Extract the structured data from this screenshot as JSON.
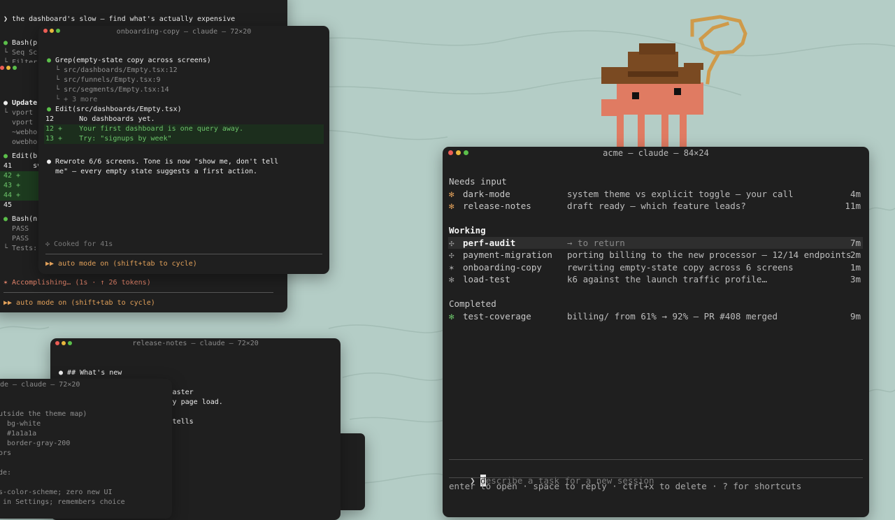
{
  "colors": {
    "background": "#b4cdc6",
    "terminal": "#1f1f1f",
    "accent_orange": "#e2a15a",
    "accent_green": "#6cc46a"
  },
  "term_back": {
    "prompt": "❯ the dashboard's slow — find what's actually expensive",
    "lines": [
      {
        "t": "● Bash(p",
        "c": "gb"
      },
      {
        "t": "└ Seq Sc",
        "c": "grey"
      },
      {
        "t": "└ Filter",
        "c": "grey"
      },
      {
        "t": "● Update",
        "c": "wb"
      },
      {
        "t": "└ vport",
        "c": "grey"
      },
      {
        "t": "  vport",
        "c": "grey"
      },
      {
        "t": "  ~webho",
        "c": "grey"
      },
      {
        "t": "  owebho",
        "c": "grey"
      },
      {
        "t": "● Edit(b",
        "c": "gb"
      },
      {
        "t": "41     sv",
        "c": "white"
      },
      {
        "t": "42 +",
        "c": "green"
      },
      {
        "t": "43 +",
        "c": "green"
      },
      {
        "t": "44 +",
        "c": "green"
      },
      {
        "t": "45",
        "c": "white"
      },
      {
        "t": "● Bash(n",
        "c": "gb"
      },
      {
        "t": "  PASS",
        "c": "grey"
      },
      {
        "t": "  PASS",
        "c": "grey"
      },
      {
        "t": "└ Tests:",
        "c": "grey"
      }
    ],
    "status": "✶ Accomplishing… (1s · ↑ 26 tokens)",
    "footer": "▶▶ auto mode on (shift+tab to cycle)"
  },
  "term_onboarding": {
    "title": "onboarding-copy — claude — 72×20",
    "lines": [
      {
        "t": "● Grep(empty-state copy across screens)",
        "c": "gb"
      },
      {
        "t": "  └ src/dashboards/Empty.tsx:12",
        "c": "grey"
      },
      {
        "t": "  └ src/funnels/Empty.tsx:9",
        "c": "grey"
      },
      {
        "t": "  └ src/segments/Empty.tsx:14",
        "c": "grey"
      },
      {
        "t": "  └ + 3 more",
        "c": "dim"
      },
      {
        "t": "● Edit(src/dashboards/Empty.tsx)",
        "c": "gb"
      },
      {
        "t": "12      No dashboards yet.",
        "c": "white"
      },
      {
        "t": "12 +    Your first dashboard is one query away.",
        "c": "green"
      },
      {
        "t": "13 +    Try: \"signups by week\"",
        "c": "green"
      },
      {
        "t": "",
        "c": "white"
      },
      {
        "t": "● Rewrote 6/6 screens. Tone is now \"show me, don't tell",
        "c": "wdot"
      },
      {
        "t": "  me\" — every empty state suggests a first action.",
        "c": "white"
      }
    ],
    "cooked": "✣ Cooked for 41s",
    "footer": "▶▶ auto mode on (shift+tab to cycle)"
  },
  "term_release": {
    "title": "release-notes — claude — 72×20",
    "lines": [
      "● ## What's new",
      "",
      "      ain query is now 6× faster",
      "      ou'll feel it on every page load.",
      "",
      "      ery blank screen now tells"
    ]
  },
  "term_darkmode": {
    "title": "de — claude — 72×20",
    "lines": [
      "utside the theme map)",
      "  bg-white",
      "  #1a1a1a",
      "  border-gray-200",
      "ors",
      "",
      "de:",
      "",
      "s-color-scheme; zero new UI",
      " in Settings; remembers choice"
    ]
  },
  "main": {
    "title": "acme — claude — 84×24",
    "sections": [
      {
        "heading": "Needs input",
        "bold": false,
        "rows": [
          {
            "icon": "✻",
            "icon_color": "#e2a15a",
            "name": "dark-mode",
            "desc": "system theme vs explicit toggle — your call",
            "time": "4m"
          },
          {
            "icon": "✻",
            "icon_color": "#e2a15a",
            "name": "release-notes",
            "desc": "draft ready — which feature leads?",
            "time": "11m"
          }
        ]
      },
      {
        "heading": "Working",
        "bold": true,
        "rows": [
          {
            "icon": "✣",
            "icon_color": "#9a9a9a",
            "name": "perf-audit",
            "desc": "→ to return",
            "time": "7m",
            "selected": true
          },
          {
            "icon": "✣",
            "icon_color": "#9a9a9a",
            "name": "payment-migration",
            "desc": "porting billing to the new processor — 12/14 endpoints",
            "time": "2m"
          },
          {
            "icon": "✶",
            "icon_color": "#9a9a9a",
            "name": "onboarding-copy",
            "desc": "rewriting empty-state copy across 6 screens",
            "time": "1m"
          },
          {
            "icon": "✻",
            "icon_color": "#9a9a9a",
            "name": "load-test",
            "desc": "k6 against the launch traffic profile…",
            "time": "3m"
          }
        ]
      },
      {
        "heading": "Completed",
        "bold": false,
        "rows": [
          {
            "icon": "✻",
            "icon_color": "#6cc46a",
            "name": "test-coverage",
            "desc": "billing/ from 61% → 92% — PR #408 merged",
            "time": "9m"
          }
        ]
      }
    ],
    "input_prompt": "❯",
    "input_first": "d",
    "input_rest": "escribe a task for a new session",
    "hints": "enter to open · space to reply · ctrl+x to delete · ? for shortcuts"
  }
}
